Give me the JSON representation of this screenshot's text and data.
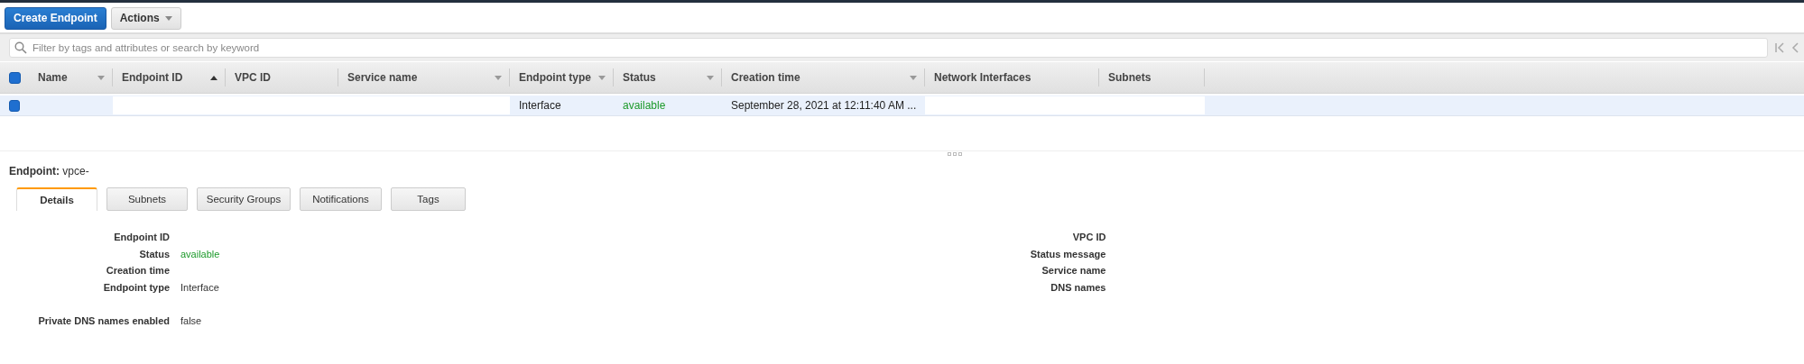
{
  "toolbar": {
    "buttons": [
      {
        "label": "Create Endpoint",
        "kind": "primary"
      },
      {
        "label": "Actions",
        "kind": "menu"
      }
    ]
  },
  "search": {
    "placeholder": "Filter by tags and attributes or search by keyword"
  },
  "table": {
    "header_checked": true,
    "columns": [
      {
        "label": "Name",
        "kind": "menu"
      },
      {
        "label": "Endpoint ID",
        "kind": "sorted"
      },
      {
        "label": "VPC ID",
        "kind": "plain"
      },
      {
        "label": "Service name",
        "kind": "menu"
      },
      {
        "label": "Endpoint type",
        "kind": "menu"
      },
      {
        "label": "Status",
        "kind": "menu"
      },
      {
        "label": "Creation time",
        "kind": "menu"
      },
      {
        "label": "Network Interfaces",
        "kind": "plain"
      },
      {
        "label": "Subnets",
        "kind": "plain"
      }
    ],
    "rows": [
      {
        "selected": true,
        "checked": true,
        "cells": [
          {
            "kind": "empty"
          },
          {
            "kind": "hidden"
          },
          {
            "kind": "hidden"
          },
          {
            "kind": "hidden"
          },
          {
            "kind": "text",
            "text": "Interface"
          },
          {
            "kind": "status",
            "text": "available"
          },
          {
            "kind": "text",
            "text": "September 28, 2021 at 12:11:40 AM ..."
          },
          {
            "kind": "hidden"
          },
          {
            "kind": "hidden"
          }
        ]
      }
    ]
  },
  "detail": {
    "title_label": "Endpoint:",
    "title_value": "vpce-",
    "tabs": [
      {
        "label": "Details",
        "selected": true
      },
      {
        "label": "Subnets",
        "selected": false
      },
      {
        "label": "Security Groups",
        "selected": false
      },
      {
        "label": "Notifications",
        "selected": false
      },
      {
        "label": "Tags",
        "selected": false
      }
    ],
    "left_groups": [
      [
        {
          "label": "Endpoint ID"
        },
        {
          "label": "Status",
          "value": "available",
          "kind": "status"
        },
        {
          "label": "Creation time"
        },
        {
          "label": "Endpoint type",
          "value": "Interface",
          "kind": "text"
        }
      ],
      [
        {
          "label": "Private DNS names enabled",
          "value": "false",
          "kind": "text"
        }
      ]
    ],
    "right_fields": [
      {
        "label": "VPC ID"
      },
      {
        "label": "Status message"
      },
      {
        "label": "Service name"
      },
      {
        "label": "DNS names"
      }
    ]
  }
}
